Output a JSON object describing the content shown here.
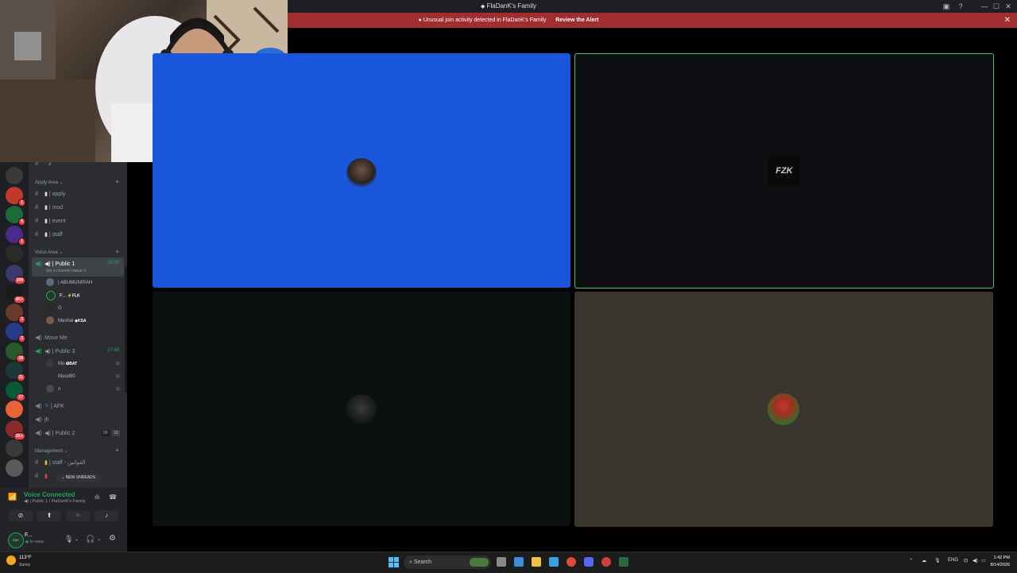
{
  "window": {
    "title": "FlaDanK's Family",
    "inbox_icon": "inbox-icon",
    "help_icon": "help-icon",
    "minimize": "—",
    "maximize": "☐",
    "close": "✕"
  },
  "alert": {
    "text": "Unusual join activity detected in FlaDanK's Family",
    "link": "Review the Alert",
    "close": "✕"
  },
  "servers": [
    {
      "badge": ""
    },
    {
      "badge": "1"
    },
    {
      "badge": "5"
    },
    {
      "badge": "1"
    },
    {
      "badge": ""
    },
    {
      "badge": "109"
    },
    {
      "badge": "4K+"
    },
    {
      "badge": "3"
    },
    {
      "badge": "3"
    },
    {
      "badge": "28"
    },
    {
      "badge": "11"
    },
    {
      "badge": "17"
    },
    {
      "badge": ""
    },
    {
      "badge": "3K+"
    },
    {
      "badge": ""
    },
    {
      "badge": ""
    }
  ],
  "channels": {
    "top_partial": "· 3",
    "apply_area": {
      "label": "Apply Area",
      "items": [
        "| apply",
        "| mod",
        "| event",
        "| staff"
      ]
    },
    "voice_area": {
      "label": "Voice Area",
      "public1": {
        "name": "| Public 1",
        "time": "28:35",
        "status": "Set a channel status"
      },
      "public1_users": [
        {
          "name": "| ABUMUNIRAH",
          "tag": ""
        },
        {
          "name": "F...",
          "tag": "FLK"
        },
        {
          "name": "G",
          "tag": ""
        },
        {
          "name": "Meshal",
          "tag": "KSA"
        }
      ],
      "move_me": "Move Me",
      "public3": {
        "name": "| Public 3",
        "time": "27:48"
      },
      "public3_users": [
        {
          "name": "Mo",
          "tag": "BAT"
        },
        {
          "name": "Mood90",
          "tag": ""
        },
        {
          "name": "n",
          "tag": ""
        }
      ],
      "afk": "| AFK",
      "jh": "jh",
      "public2": {
        "name": "| Public 2",
        "count1": "00",
        "count2": "10"
      }
    },
    "management": {
      "label": "Management",
      "items": [
        "| staff - القوانين"
      ]
    },
    "new_unreads": "NEW UNREADS"
  },
  "voice_panel": {
    "title": "Voice Connected",
    "subtitle": "| Public 1 / FlaDanK's Family"
  },
  "user_panel": {
    "name": "F...",
    "status": "In voice"
  },
  "tiles": [
    {
      "label": ""
    },
    {
      "label": "FZK"
    },
    {
      "label": ""
    },
    {
      "label": ""
    }
  ],
  "taskbar": {
    "weather_temp": "113°F",
    "weather_desc": "Sunny",
    "search": "Search",
    "lang": "ENG",
    "time": "1:42 PM",
    "date": "8/14/2026"
  },
  "colors": {
    "accent_green": "#23a55a",
    "alert_red": "#a12d2f",
    "tile_blue": "#1a56db",
    "speaking_border": "#4ec76b"
  }
}
